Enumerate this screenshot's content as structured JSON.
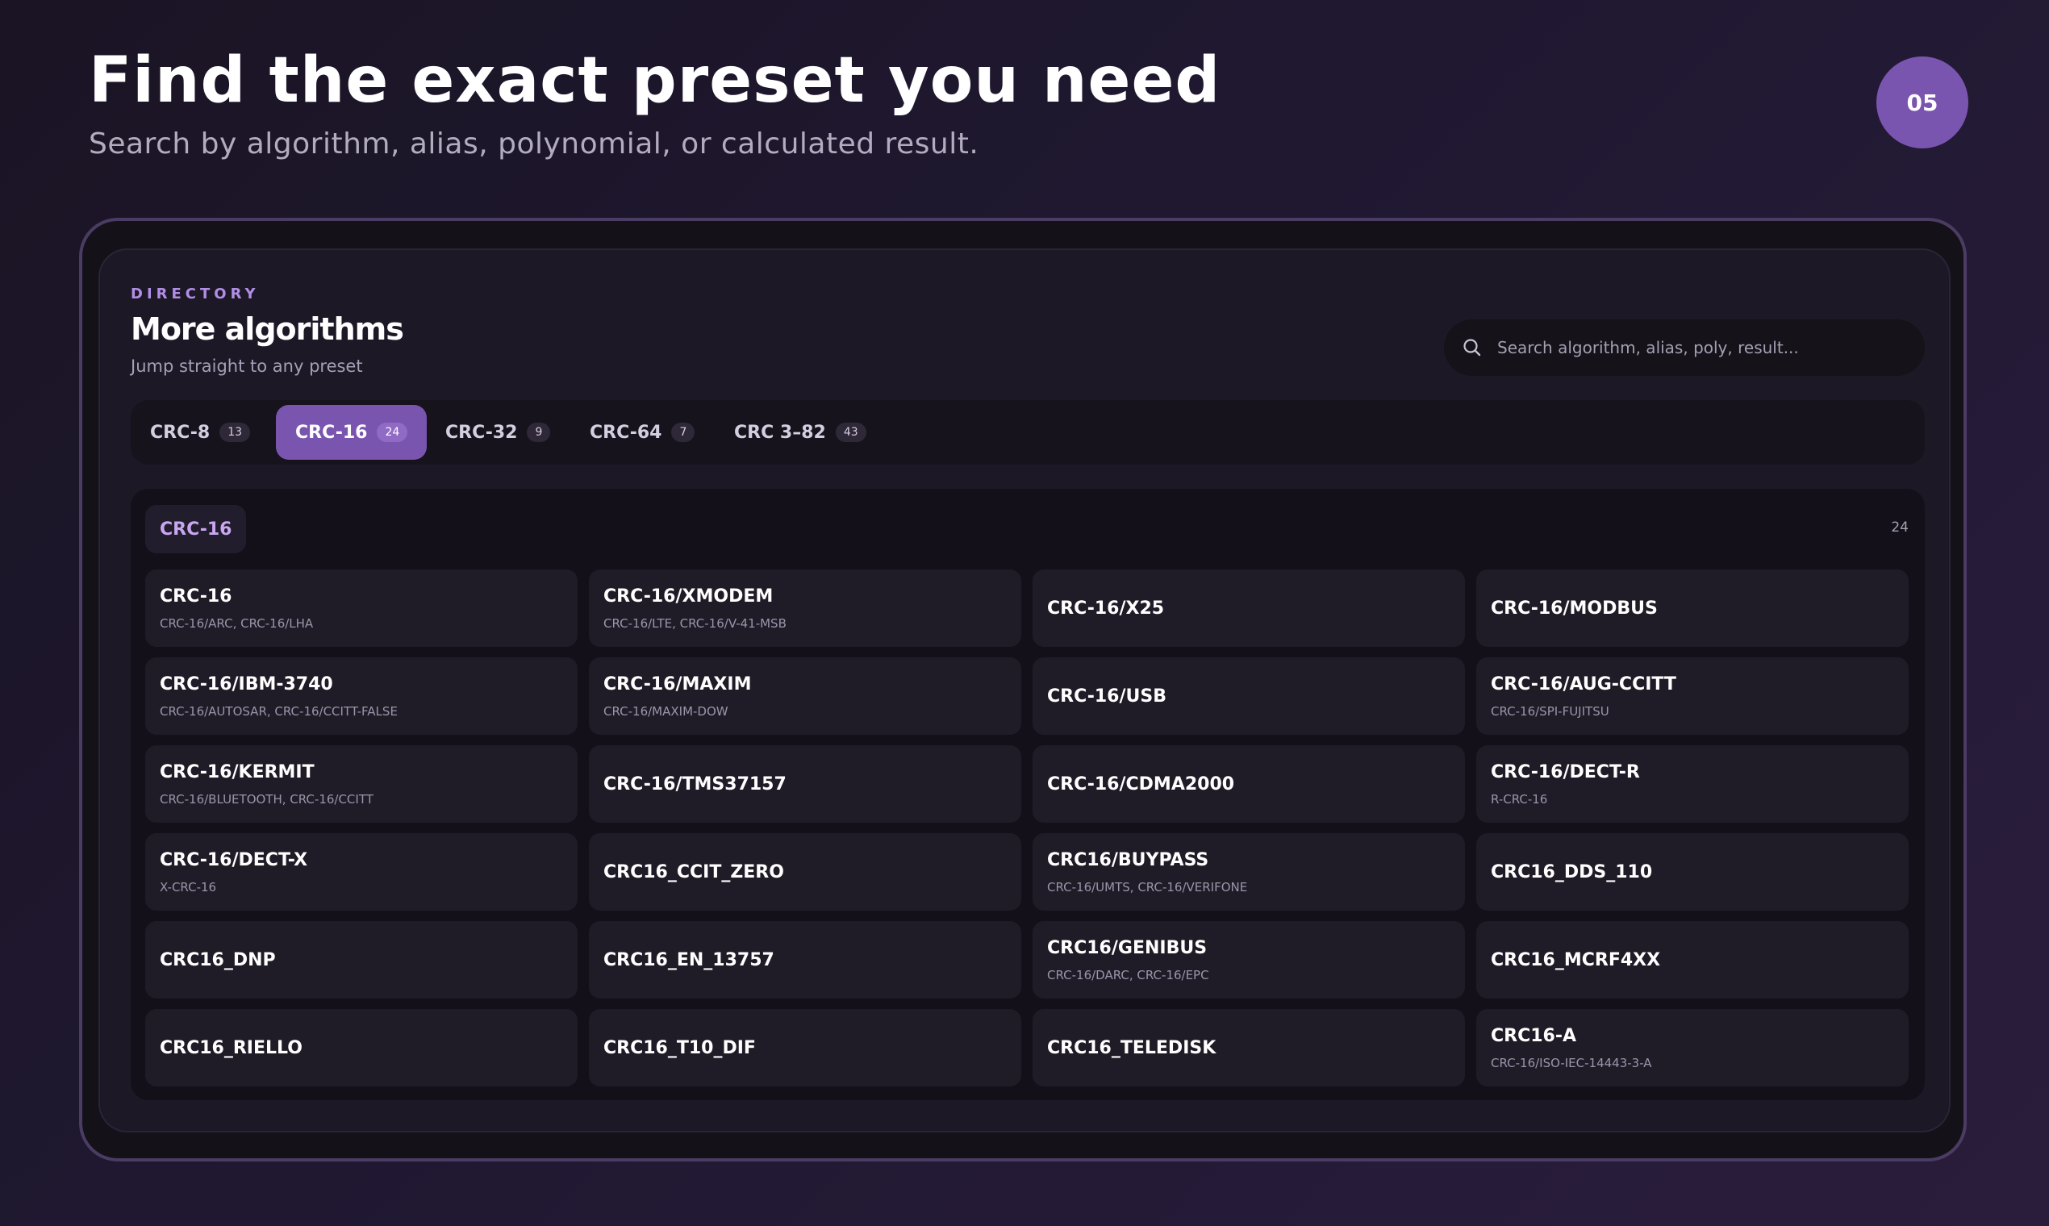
{
  "header": {
    "title": "Find the exact preset you need",
    "subtitle": "Search by algorithm, alias, polynomial, or calculated result.",
    "step": "05"
  },
  "panel": {
    "eyebrow": "DIRECTORY",
    "title": "More algorithms",
    "subtitle": "Jump straight to any preset",
    "search_placeholder": "Search algorithm, alias, poly, result..."
  },
  "tabs": [
    {
      "label": "CRC-8",
      "count": "13",
      "active": false
    },
    {
      "label": "CRC-16",
      "count": "24",
      "active": true
    },
    {
      "label": "CRC-32",
      "count": "9",
      "active": false
    },
    {
      "label": "CRC-64",
      "count": "7",
      "active": false
    },
    {
      "label": "CRC 3–82",
      "count": "43",
      "active": false
    }
  ],
  "group": {
    "label": "CRC-16",
    "count": "24",
    "items": [
      {
        "name": "CRC-16",
        "aliases": "CRC-16/ARC, CRC-16/LHA"
      },
      {
        "name": "CRC-16/XMODEM",
        "aliases": "CRC-16/LTE, CRC-16/V-41-MSB"
      },
      {
        "name": "CRC-16/X25",
        "aliases": ""
      },
      {
        "name": "CRC-16/MODBUS",
        "aliases": ""
      },
      {
        "name": "CRC-16/IBM-3740",
        "aliases": "CRC-16/AUTOSAR, CRC-16/CCITT-FALSE"
      },
      {
        "name": "CRC-16/MAXIM",
        "aliases": "CRC-16/MAXIM-DOW"
      },
      {
        "name": "CRC-16/USB",
        "aliases": ""
      },
      {
        "name": "CRC-16/AUG-CCITT",
        "aliases": "CRC-16/SPI-FUJITSU"
      },
      {
        "name": "CRC-16/KERMIT",
        "aliases": "CRC-16/BLUETOOTH, CRC-16/CCITT"
      },
      {
        "name": "CRC-16/TMS37157",
        "aliases": ""
      },
      {
        "name": "CRC-16/CDMA2000",
        "aliases": ""
      },
      {
        "name": "CRC-16/DECT-R",
        "aliases": "R-CRC-16"
      },
      {
        "name": "CRC-16/DECT-X",
        "aliases": "X-CRC-16"
      },
      {
        "name": "CRC16_CCIT_ZERO",
        "aliases": ""
      },
      {
        "name": "CRC16/BUYPASS",
        "aliases": "CRC-16/UMTS, CRC-16/VERIFONE"
      },
      {
        "name": "CRC16_DDS_110",
        "aliases": ""
      },
      {
        "name": "CRC16_DNP",
        "aliases": ""
      },
      {
        "name": "CRC16_EN_13757",
        "aliases": ""
      },
      {
        "name": "CRC16/GENIBUS",
        "aliases": "CRC-16/DARC, CRC-16/EPC"
      },
      {
        "name": "CRC16_MCRF4XX",
        "aliases": ""
      },
      {
        "name": "CRC16_RIELLO",
        "aliases": ""
      },
      {
        "name": "CRC16_T10_DIF",
        "aliases": ""
      },
      {
        "name": "CRC16_TELEDISK",
        "aliases": ""
      },
      {
        "name": "CRC16-A",
        "aliases": "CRC-16/ISO-IEC-14443-3-A"
      }
    ]
  },
  "colors": {
    "accent": "#7a55b0",
    "eyebrow": "#b28ee6",
    "group_tag_text": "#c9a6f0"
  }
}
